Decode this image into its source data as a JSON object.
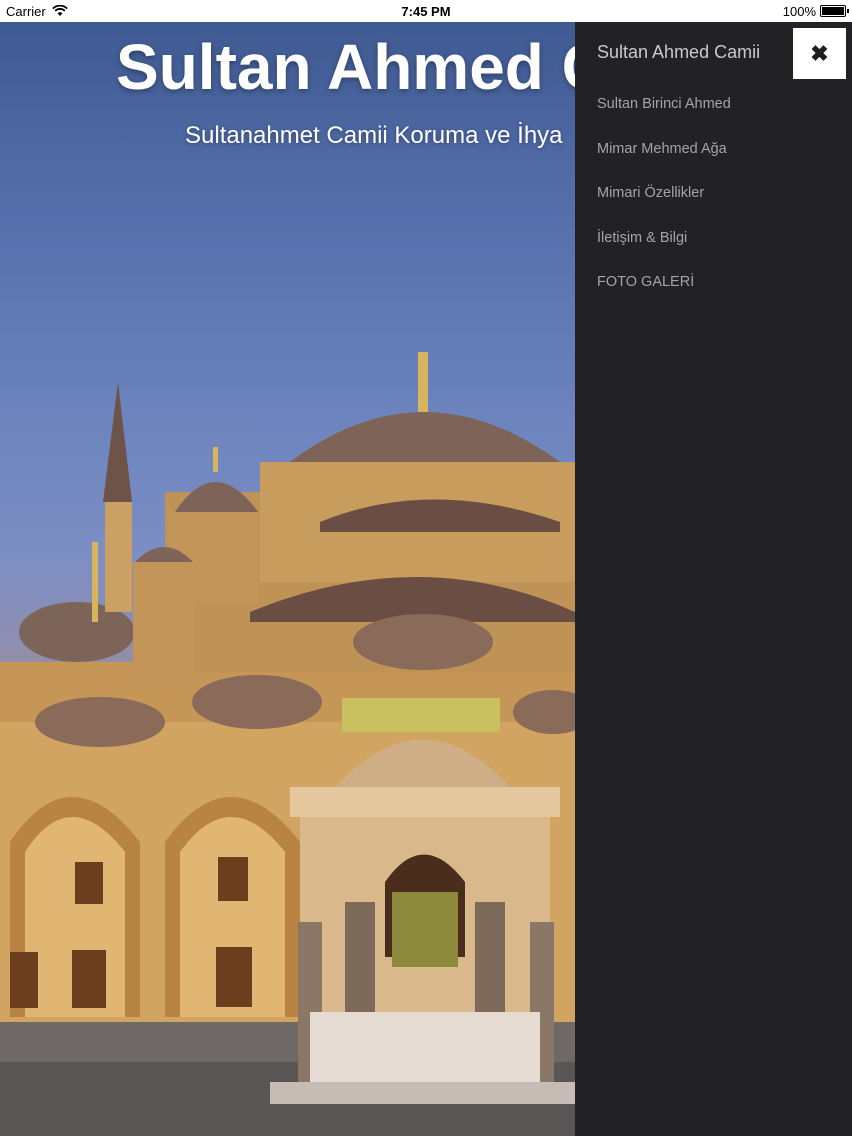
{
  "status_bar": {
    "carrier": "Carrier",
    "time": "7:45 PM",
    "battery": "100%",
    "battery_level": 1.0
  },
  "hero": {
    "title": "Sultan Ahmed Camii",
    "subtitle": "Sultanahmet Camii Koruma ve İhya",
    "image": "blue-mosque-photo"
  },
  "menu": {
    "title": "Sultan Ahmed Camii",
    "close_icon": "close-icon",
    "items": [
      {
        "label": "Sultan Birinci Ahmed"
      },
      {
        "label": "Mimar Mehmed Ağa"
      },
      {
        "label": "Mimari Özellikler"
      },
      {
        "label": "İletişim & Bilgi"
      },
      {
        "label": "FOTO GALERİ"
      }
    ]
  },
  "colors": {
    "menu_background": "#222226",
    "menu_text": "#a3a3a8",
    "title_text": "#ffffff"
  }
}
